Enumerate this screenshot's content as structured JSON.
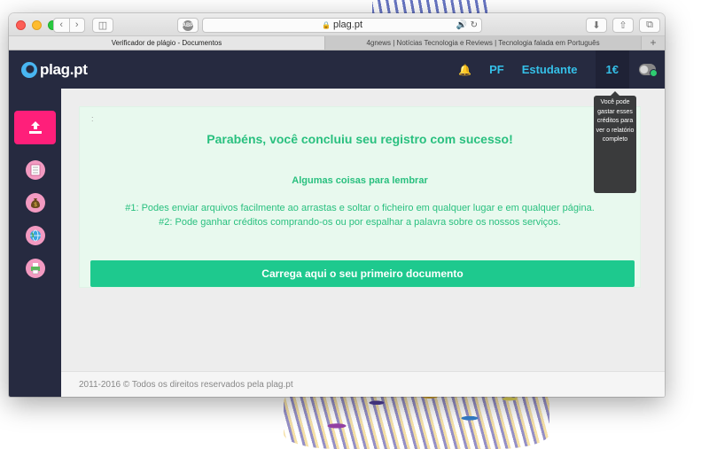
{
  "browser": {
    "address": "plag.pt",
    "abp_label": "ABP",
    "tabs": [
      {
        "label": "Verificador de plágio - Documentos"
      },
      {
        "label": "4gnews | Notícias Tecnologia e Reviews | Tecnologia falada em Português"
      }
    ],
    "new_tab": "+"
  },
  "app": {
    "logo_text": "plag.pt",
    "nav": {
      "initials": "PF",
      "plan": "Estudante",
      "credits": "1€"
    },
    "tooltip": "Você pode gastar esses créditos para ver o relatório completo",
    "sidebar": {
      "items": [
        {
          "icon": "upload-icon"
        },
        {
          "icon": "document-icon"
        },
        {
          "icon": "money-bag-icon"
        },
        {
          "icon": "globe-icon"
        },
        {
          "icon": "printer-icon"
        }
      ]
    },
    "panel": {
      "colon": ":",
      "title": "Parabéns, você concluiu seu registro com sucesso!",
      "subtitle": "Algumas coisas para lembrar",
      "tip1": "#1: Podes enviar arquivos facilmente ao arrastas e soltar o ficheiro em qualquer lugar e em qualquer página.",
      "tip2": "#2: Pode ganhar créditos comprando-os ou por espalhar a palavra sobre os nossos serviços.",
      "cta": "Carrega aqui o seu primeiro documento"
    },
    "footer": "2011-2016 © Todos os direitos reservados pela plag.pt"
  },
  "colors": {
    "brand_dark": "#262a40",
    "accent_cyan": "#35c0e8",
    "accent_green": "#1ec98e",
    "upload_pink": "#ff1f7a"
  }
}
